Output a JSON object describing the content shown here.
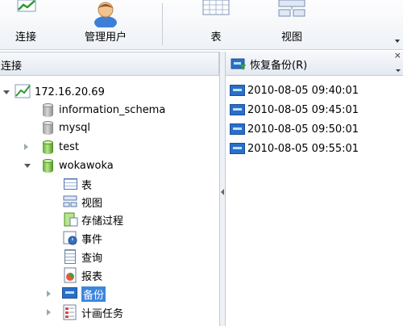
{
  "toolbar": {
    "buttons": [
      {
        "label": "连接"
      },
      {
        "label": "管理用户"
      },
      {
        "label": "表"
      },
      {
        "label": "视图"
      }
    ]
  },
  "left_panel": {
    "header": "连接",
    "tree": [
      {
        "label": "172.16.20.69",
        "icon": "server-connection-icon"
      },
      {
        "label": "information_schema",
        "icon": "database-gray-icon"
      },
      {
        "label": "mysql",
        "icon": "database-gray-icon"
      },
      {
        "label": "test",
        "icon": "database-green-icon"
      },
      {
        "label": "wokawoka",
        "icon": "database-green-icon"
      },
      {
        "label": "表",
        "icon": "table-icon"
      },
      {
        "label": "视图",
        "icon": "view-icon"
      },
      {
        "label": "存储过程",
        "icon": "procedure-icon"
      },
      {
        "label": "事件",
        "icon": "event-clock-icon"
      },
      {
        "label": "查询",
        "icon": "query-icon"
      },
      {
        "label": "报表",
        "icon": "report-icon"
      },
      {
        "label": "备份",
        "icon": "backup-icon",
        "selected": true
      },
      {
        "label": "计画任务",
        "icon": "schedule-icon"
      }
    ]
  },
  "right_panel": {
    "restore_label": "恢复备份(R)",
    "backups": [
      {
        "label": "2010-08-05 09:40:01"
      },
      {
        "label": "2010-08-05 09:45:01"
      },
      {
        "label": "2010-08-05 09:50:01"
      },
      {
        "label": "2010-08-05 09:55:01"
      }
    ]
  },
  "colors": {
    "selection": "#3d86de",
    "panel_header": "#e4e9f1",
    "border": "#c3cbd7"
  }
}
